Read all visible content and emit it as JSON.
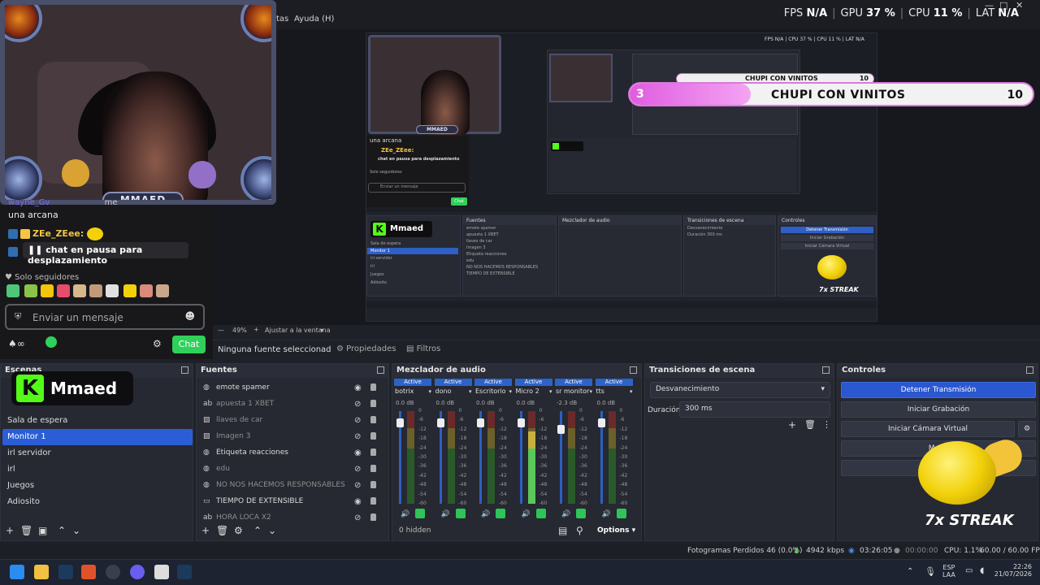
{
  "window": {
    "menu_visible": [
      "tas",
      "Ayuda (H)"
    ],
    "stats": {
      "fps_label": "FPS",
      "fps_value": "N/A",
      "gpu_label": "GPU",
      "gpu_value": "37 %",
      "cpu_label": "CPU",
      "cpu_value": "11 %",
      "lat_label": "LAT",
      "lat_value": "N/A"
    },
    "controls": [
      "—",
      "□",
      "✕"
    ]
  },
  "webcam": {
    "name_plate": "MMAED"
  },
  "hype_train": {
    "level": "3",
    "title": "CHUPI CON VINITOS",
    "count": "10",
    "progress": 0.3,
    "mini_title": "CHUPI CON VINITOS",
    "mini_count": "10"
  },
  "chat": {
    "partial_line_user": "wayne_Gv",
    "partial_line_tail": "me",
    "line1": "una arcana",
    "user2": "ZEe_ZEee:",
    "paused": "chat en pausa para desplazamiento",
    "followers_only": "Solo seguidores",
    "input_placeholder": "Enviar un mensaje",
    "chat_button": "Chat"
  },
  "preview": {
    "zoom": "49%",
    "fit": "Ajustar a la ventana",
    "no_source": "Ninguna fuente seleccionad",
    "properties": "Propiedades",
    "filters": "Filtros",
    "mini_chat_line1": "una arcana",
    "mini_chat_user": "ZEe_ZEee:",
    "mini_chat_paused": "chat en pausa para desplazamiento",
    "mini_followers": "Solo seguidores",
    "mini_input": "Enviar un mensaje",
    "mini_chat_btn": "Chat",
    "mini_logo": "Mmaed",
    "mini_streak": "7x STREAK",
    "mini_stats": "FPS N/A | CPU 37 % | CPU 11 % | LAT N/A"
  },
  "scenes": {
    "title": "Escenas",
    "items": [
      "Sala de espera",
      "Monitor 1",
      "irl servidor",
      "irl",
      "Juegos",
      "Adiosito"
    ],
    "selected_index": 1
  },
  "logo": {
    "k": "K",
    "name": "Mmaed"
  },
  "sources": {
    "title": "Fuentes",
    "items": [
      {
        "name": "emote spamer",
        "visible": true,
        "icon": "globe-icon"
      },
      {
        "name": "apuesta 1 XBET",
        "visible": false,
        "icon": "text-icon"
      },
      {
        "name": "llaves de car",
        "visible": false,
        "icon": "image-icon"
      },
      {
        "name": "Imagen 3",
        "visible": false,
        "icon": "image-icon"
      },
      {
        "name": "Etiqueta reacciones",
        "visible": true,
        "icon": "globe-icon"
      },
      {
        "name": "edu",
        "visible": false,
        "icon": "globe-icon"
      },
      {
        "name": "NO NOS HACEMOS RESPONSABLES",
        "visible": false,
        "icon": "globe-icon"
      },
      {
        "name": "TIEMPO DE EXTENSIBLE",
        "visible": true,
        "icon": "window-icon"
      },
      {
        "name": "HORA LOCA X2",
        "visible": false,
        "icon": "text-icon"
      }
    ]
  },
  "mixer": {
    "title": "Mezclador de audio",
    "active_label": "Active",
    "channels": [
      {
        "name": "botrix",
        "db": "0.0 dB",
        "level": 0.0,
        "fader": 0.92
      },
      {
        "name": "dono",
        "db": "0.0 dB",
        "level": 0.0,
        "fader": 0.92
      },
      {
        "name": "Escritorio",
        "db": "0.0 dB",
        "level": 0.0,
        "fader": 0.92
      },
      {
        "name": "Micro 2",
        "db": "0.0 dB",
        "level": 0.78,
        "fader": 0.92
      },
      {
        "name": "sr monitor",
        "db": "-2.3 dB",
        "level": 0.0,
        "fader": 0.85
      },
      {
        "name": "tts",
        "db": "0.0 dB",
        "level": 0.0,
        "fader": 0.92
      }
    ],
    "scale": [
      "0",
      "-6",
      "-12",
      "-18",
      "-24",
      "-30",
      "-36",
      "-42",
      "-48",
      "-54",
      "-60"
    ],
    "hidden": "0 hidden",
    "options": "Options"
  },
  "transitions": {
    "title": "Transiciones de escena",
    "selected": "Desvanecimiento",
    "duration_label": "Duración",
    "duration_value": "300 ms"
  },
  "controls": {
    "title": "Controles",
    "stop_stream": "Detener Transmisión",
    "start_recording": "Iniciar Grabación",
    "virtual_cam": "Iniciar Cámara Virtual",
    "studio_mode": "Mode"
  },
  "streak": {
    "text": "7x STREAK"
  },
  "status": {
    "dropped": "Fotogramas Perdidos 46 (0.0%)",
    "bitrate": "4942 kbps",
    "stream_time": "03:26:05",
    "rec_time": "00:00:00",
    "cpu": "CPU: 1.1%",
    "fps": "60.00 / 60.00 FPS"
  },
  "taskbar": {
    "lang1": "ESP",
    "lang2": "LAA",
    "time": "22:26",
    "date": "21/07/2026"
  },
  "colors": {
    "accent": "#2b57d0",
    "kick_green": "#53fc18",
    "hype_pink": "#e05ce0"
  }
}
